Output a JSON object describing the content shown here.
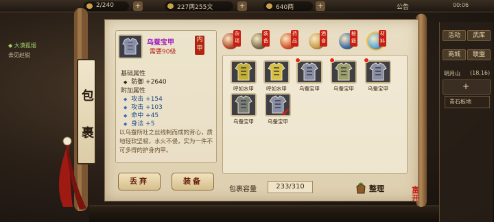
{
  "topbar": {
    "stamina": "2/240",
    "silver": "227两255文",
    "gold": "640两",
    "announcement": "公告",
    "time": "00:06"
  },
  "quest": {
    "title": "◆ 大漠孤烟",
    "subtitle": "去见赵锐"
  },
  "right_panel": {
    "activity": "活动",
    "ranking": "武库",
    "shop": "商城",
    "dungeon": "联盟",
    "location": "明月山",
    "coords": "(18,16)",
    "plus": "+",
    "stone": "青石板地"
  },
  "panel_title": [
    "包",
    "裹"
  ],
  "item": {
    "name": "乌蚕宝甲",
    "requirement": "需要90级",
    "equip_tag": "内甲",
    "base_label": "基础属性",
    "base_stats": [
      {
        "name": "防御",
        "value": "+2640"
      }
    ],
    "extra_label": "附加属性",
    "extra_stats": [
      {
        "name": "攻击",
        "value": "+154"
      },
      {
        "name": "攻击",
        "value": "+103"
      },
      {
        "name": "命中",
        "value": "+45"
      },
      {
        "name": "身法",
        "value": "+5"
      }
    ],
    "description": "以乌蚕所吐之丝线制而成的背心，质地轻软坚韧，水火不侵，实为一件不可多得的护身内甲。"
  },
  "buttons": {
    "discard": "丢弃",
    "equip": "装备",
    "sort": "整理"
  },
  "categories": [
    {
      "label": "杂项",
      "icon": "misc-icon",
      "color": "#b2442a"
    },
    {
      "label": "装备",
      "icon": "equipment-icon",
      "color": "#7a6a4a"
    },
    {
      "label": "药品",
      "icon": "medicine-icon",
      "color": "#d2502a"
    },
    {
      "label": "酒食",
      "icon": "food-icon",
      "color": "#c89a4a"
    },
    {
      "label": "秘籍",
      "icon": "book-icon",
      "color": "#3a6aa0"
    },
    {
      "label": "材料",
      "icon": "material-icon",
      "color": "#58a8d8"
    }
  ],
  "grid_items": [
    {
      "label": "呼如水甲",
      "color": "#c4b030",
      "new": false,
      "selected": false
    },
    {
      "label": "呼如水甲",
      "color": "#d8c040",
      "new": false,
      "selected": false
    },
    {
      "label": "乌蚕宝甲",
      "color": "#8a8fa8",
      "new": true,
      "selected": false
    },
    {
      "label": "乌蚕宝甲",
      "color": "#9aa06a",
      "new": true,
      "selected": false
    },
    {
      "label": "乌蚕宝甲",
      "color": "#8a8fa8",
      "new": true,
      "selected": false
    },
    {
      "label": "乌蚕宝甲",
      "color": "#7a8078",
      "new": false,
      "selected": false
    },
    {
      "label": "乌蚕宝甲",
      "color": "#8a8fa8",
      "new": false,
      "selected": true
    }
  ],
  "capacity": {
    "label": "包裹容量",
    "value": "233/310"
  },
  "seal": "富开"
}
